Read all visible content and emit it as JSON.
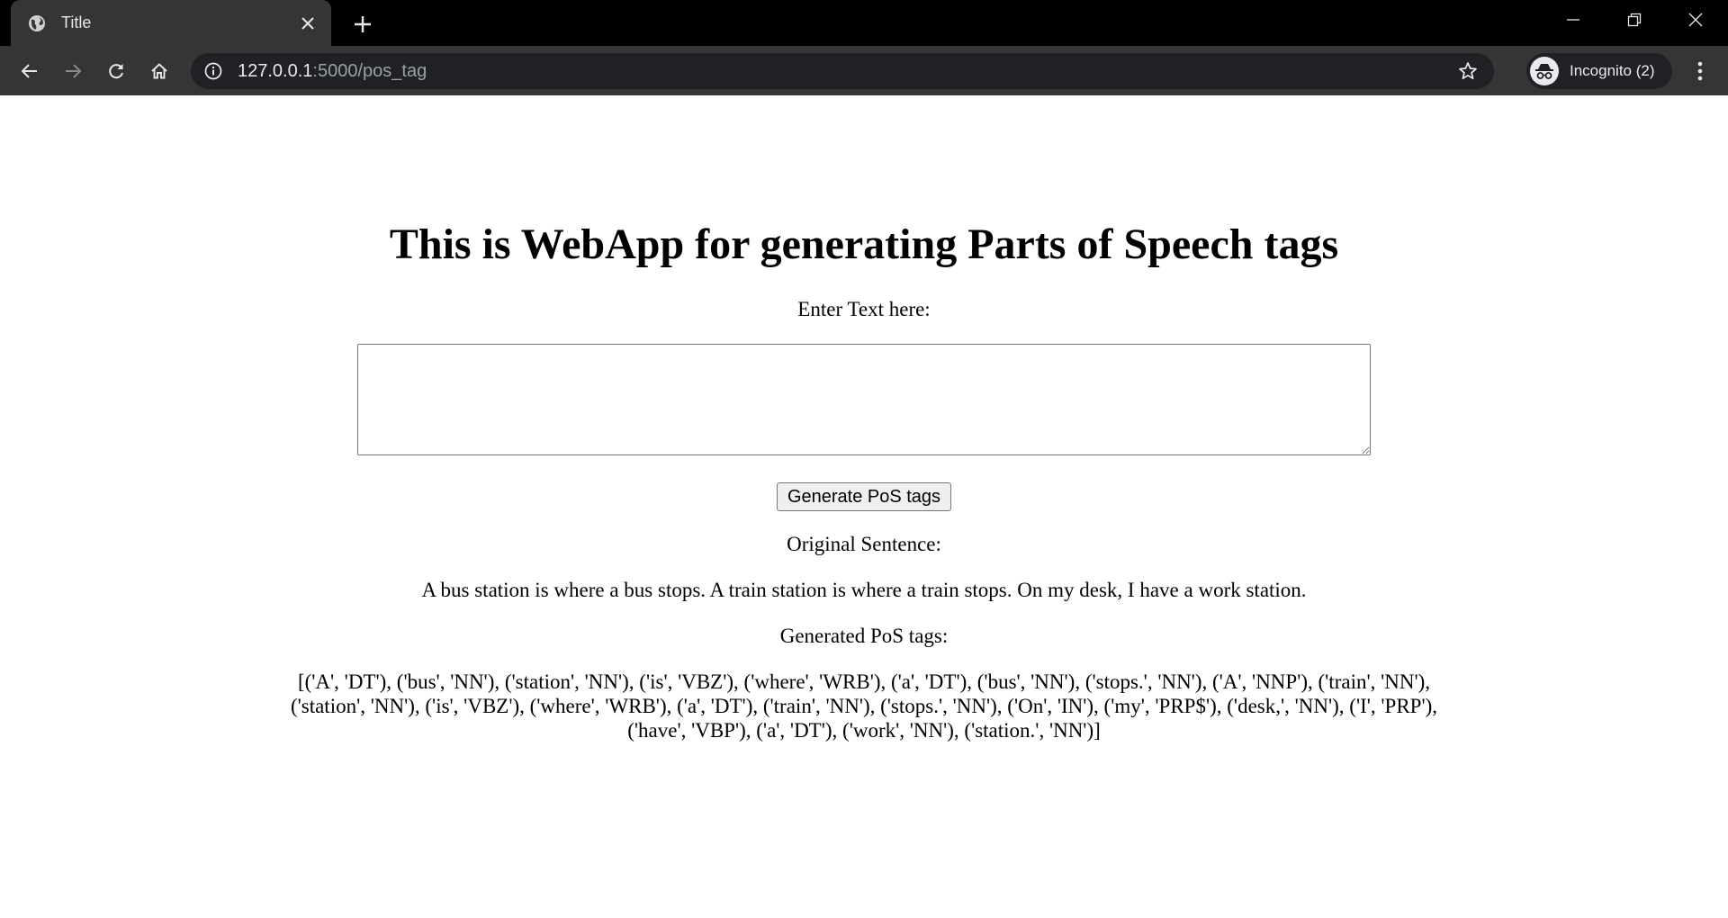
{
  "browser": {
    "tab_title": "Title",
    "url_host": "127.0.0.1",
    "url_path": ":5000/pos_tag",
    "profile_label": "Incognito (2)",
    "icons": {
      "favicon": "globe-icon",
      "tab_close": "close-icon",
      "new_tab": "plus-icon",
      "back": "arrow-left-icon",
      "forward": "arrow-right-icon",
      "reload": "reload-icon",
      "home": "home-icon",
      "site_info": "info-icon",
      "bookmark": "star-icon",
      "incognito": "incognito-icon",
      "menu": "kebab-menu-icon",
      "minimize": "minimize-icon",
      "restore": "restore-icon",
      "close_window": "close-icon"
    }
  },
  "page": {
    "heading": "This is WebApp for generating Parts of Speech tags",
    "input_label": "Enter Text here:",
    "input_value": "",
    "submit_label": "Generate PoS tags",
    "original_label": "Original Sentence:",
    "original_sentence": "A bus station is where a bus stops. A train station is where a train stops. On my desk, I have a work station.",
    "generated_label": "Generated PoS tags:",
    "generated_tags": "[('A', 'DT'), ('bus', 'NN'), ('station', 'NN'), ('is', 'VBZ'), ('where', 'WRB'), ('a', 'DT'), ('bus', 'NN'), ('stops.', 'NN'), ('A', 'NNP'), ('train', 'NN'), ('station', 'NN'), ('is', 'VBZ'), ('where', 'WRB'), ('a', 'DT'), ('train', 'NN'), ('stops.', 'NN'), ('On', 'IN'), ('my', 'PRP$'), ('desk,', 'NN'), ('I', 'PRP'), ('have', 'VBP'), ('a', 'DT'), ('work', 'NN'), ('station.', 'NN')]"
  }
}
